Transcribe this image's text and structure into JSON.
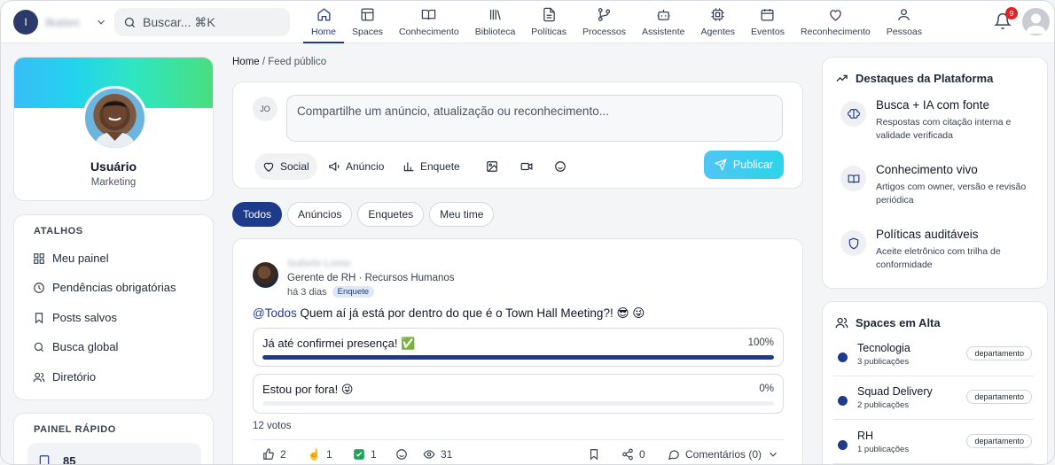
{
  "topbar": {
    "org_initial": "I",
    "org_name": "Ikatec",
    "search_placeholder": "Buscar... ⌘K",
    "nav": [
      {
        "label": "Home",
        "icon": "home-icon",
        "active": true
      },
      {
        "label": "Spaces",
        "icon": "layout-icon"
      },
      {
        "label": "Conhecimento",
        "icon": "book-open-icon"
      },
      {
        "label": "Biblioteca",
        "icon": "library-icon"
      },
      {
        "label": "Políticas",
        "icon": "document-icon"
      },
      {
        "label": "Processos",
        "icon": "git-branch-icon"
      },
      {
        "label": "Assistente",
        "icon": "bot-icon"
      },
      {
        "label": "Agentes",
        "icon": "cpu-icon"
      },
      {
        "label": "Eventos",
        "icon": "calendar-icon"
      },
      {
        "label": "Reconhecimento",
        "icon": "heart-icon"
      },
      {
        "label": "Pessoas",
        "icon": "user-icon"
      }
    ],
    "notifications_count": "9"
  },
  "profile": {
    "name": "Usuário",
    "role": "Marketing"
  },
  "shortcuts": {
    "title": "ATALHOS",
    "items": [
      {
        "label": "Meu painel",
        "icon": "grid-icon"
      },
      {
        "label": "Pendências obrigatórias",
        "icon": "clock-icon"
      },
      {
        "label": "Posts salvos",
        "icon": "bookmark-icon"
      },
      {
        "label": "Busca global",
        "icon": "search-icon"
      },
      {
        "label": "Diretório",
        "icon": "users-icon"
      }
    ]
  },
  "quick_panel": {
    "title": "PAINEL RÁPIDO",
    "stat_value": "85"
  },
  "breadcrumb": {
    "home": "Home",
    "current": "Feed público"
  },
  "composer": {
    "initials": "JO",
    "placeholder": "Compartilhe um anúncio, atualização ou reconhecimento...",
    "tools": {
      "social": "Social",
      "announcement": "Anúncio",
      "poll": "Enquete"
    },
    "publish_label": "Publicar"
  },
  "filters": [
    "Todos",
    "Anúncios",
    "Enquetes",
    "Meu time"
  ],
  "post": {
    "author": "Izabele Leme",
    "role": "Gerente de RH · Recursos Humanos",
    "time": "há 3 dias",
    "tag": "Enquete",
    "mention": "@Todos",
    "text": " Quem aí já está por dentro do que é o Town Hall Meeting?! 😎 😜",
    "poll": [
      {
        "label": "Já até confirmei presença! ✅",
        "percent_text": "100%",
        "percent": 100
      },
      {
        "label": "Estou por fora! 😜",
        "percent_text": "0%",
        "percent": 0
      }
    ],
    "votes": "12 votos",
    "reactions": {
      "like": "2",
      "clap": "1",
      "check": "1",
      "views": "31",
      "shares": "0",
      "comments": "Comentários (0)"
    }
  },
  "highlights": {
    "title": "Destaques da Plataforma",
    "items": [
      {
        "title": "Busca + IA com fonte",
        "desc": "Respostas com citação interna e validade verificada",
        "icon": "brain-icon"
      },
      {
        "title": "Conhecimento vivo",
        "desc": "Artigos com owner, versão e revisão periódica",
        "icon": "book-open-icon"
      },
      {
        "title": "Políticas auditáveis",
        "desc": "Aceite eletrônico com trilha de conformidade",
        "icon": "shield-icon"
      }
    ]
  },
  "spaces": {
    "title": "Spaces em Alta",
    "items": [
      {
        "name": "Tecnologia",
        "count": "3 publicações",
        "badge": "departamento"
      },
      {
        "name": "Squad Delivery",
        "count": "2 publicações",
        "badge": "departamento"
      },
      {
        "name": "RH",
        "count": "1 publicações",
        "badge": "departamento"
      }
    ]
  },
  "colors": {
    "brand": "#1e3a8a",
    "accent_cyan": "#2dd4e8",
    "badge_red": "#dc2626"
  }
}
